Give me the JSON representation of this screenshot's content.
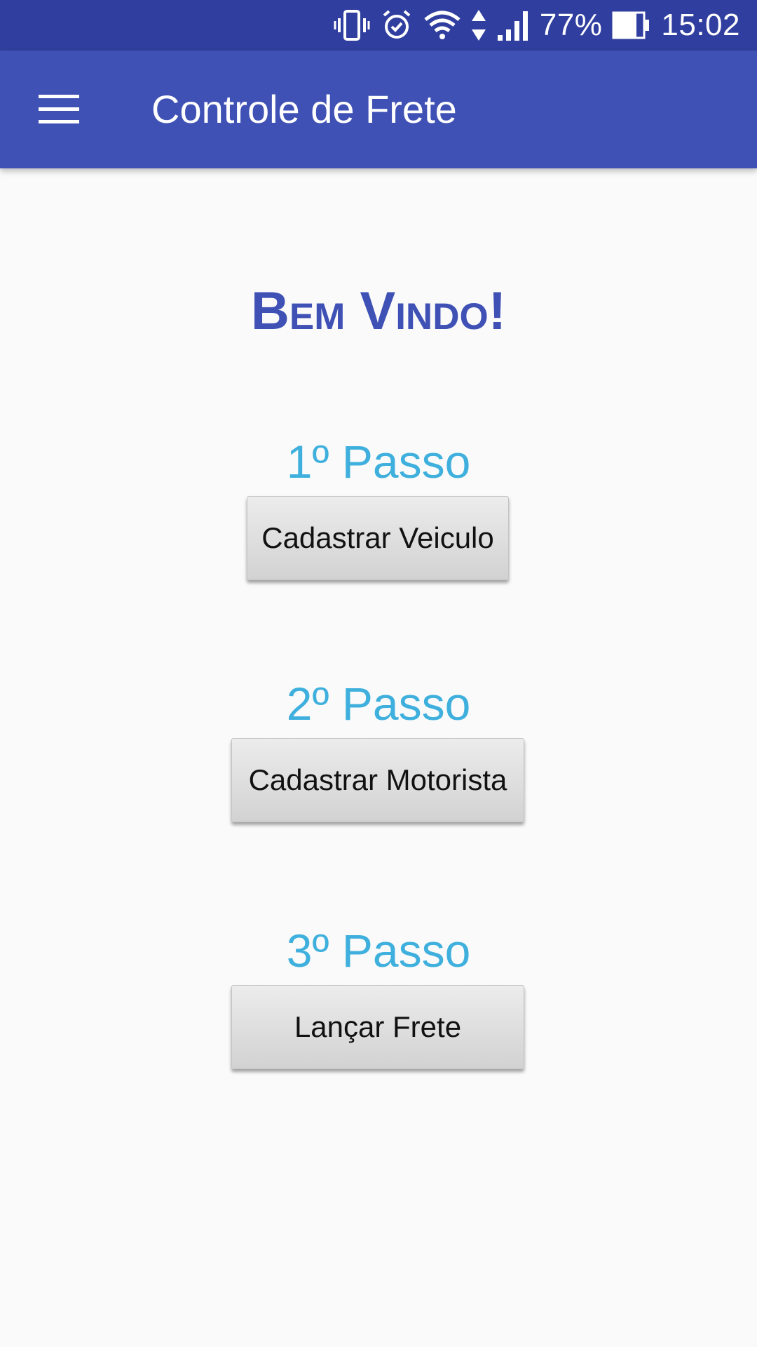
{
  "status_bar": {
    "icons": [
      "vibrate-icon",
      "alarm-icon",
      "wifi-icon",
      "data-arrows-icon",
      "signal-icon",
      "battery-icon"
    ],
    "battery_percent": "77%",
    "time": "15:02",
    "background_color": "#303f9f"
  },
  "app_bar": {
    "menu_icon": "hamburger-menu-icon",
    "title": "Controle de Frete",
    "background_color": "#3f51b5"
  },
  "main": {
    "welcome": "Bem Vindo!",
    "steps": [
      {
        "label": "1º Passo",
        "button": "Cadastrar Veiculo"
      },
      {
        "label": "2º Passo",
        "button": "Cadastrar Motorista"
      },
      {
        "label": "3º Passo",
        "button": "Lançar Frete"
      }
    ],
    "step_label_color": "#3fb0dd",
    "welcome_color": "#3f51b5"
  }
}
